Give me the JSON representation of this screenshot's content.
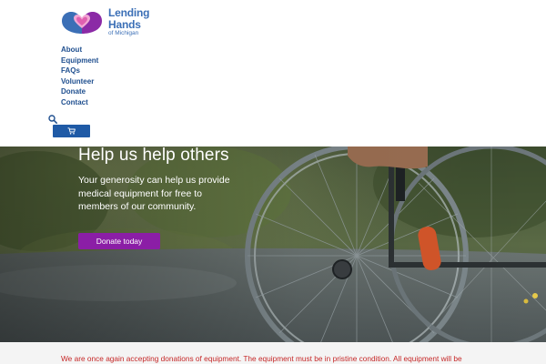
{
  "brand": {
    "name_line1": "Lending",
    "name_line2": "Hands",
    "name_line3": "of Michigan",
    "colors": {
      "blue": "#3b6fb6",
      "purple": "#8b2aa6",
      "heart": "#e060b0"
    }
  },
  "nav": {
    "items": [
      {
        "label": "About"
      },
      {
        "label": "Equipment"
      },
      {
        "label": "FAQs"
      },
      {
        "label": "Volunteer"
      },
      {
        "label": "Donate"
      },
      {
        "label": "Contact"
      }
    ]
  },
  "header_actions": {
    "search_icon": "search-icon",
    "cart_icon": "cart-icon",
    "cart_color": "#1f5aa6"
  },
  "hero": {
    "title": "Help us help others",
    "body": "Your generosity can help us provide medical equipment for free to members of our community.",
    "cta_label": "Donate today",
    "cta_color": "#8b1ea6"
  },
  "notice": {
    "text": "We are once again accepting donations of equipment. The equipment must be in pristine condition. All equipment will be",
    "color": "#c62828"
  }
}
